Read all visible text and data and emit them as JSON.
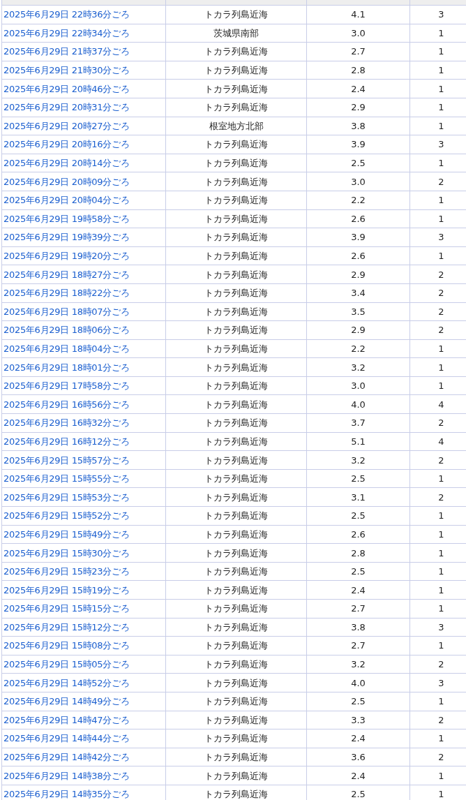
{
  "table": {
    "rows": [
      {
        "time": "2025年6月29日 22時36分ごろ",
        "area": "トカラ列島近海",
        "magnitude": "4.1",
        "intensity": "3"
      },
      {
        "time": "2025年6月29日 22時34分ごろ",
        "area": "茨城県南部",
        "magnitude": "3.0",
        "intensity": "1"
      },
      {
        "time": "2025年6月29日 21時37分ごろ",
        "area": "トカラ列島近海",
        "magnitude": "2.7",
        "intensity": "1"
      },
      {
        "time": "2025年6月29日 21時30分ごろ",
        "area": "トカラ列島近海",
        "magnitude": "2.8",
        "intensity": "1"
      },
      {
        "time": "2025年6月29日 20時46分ごろ",
        "area": "トカラ列島近海",
        "magnitude": "2.4",
        "intensity": "1"
      },
      {
        "time": "2025年6月29日 20時31分ごろ",
        "area": "トカラ列島近海",
        "magnitude": "2.9",
        "intensity": "1"
      },
      {
        "time": "2025年6月29日 20時27分ごろ",
        "area": "根室地方北部",
        "magnitude": "3.8",
        "intensity": "1"
      },
      {
        "time": "2025年6月29日 20時16分ごろ",
        "area": "トカラ列島近海",
        "magnitude": "3.9",
        "intensity": "3"
      },
      {
        "time": "2025年6月29日 20時14分ごろ",
        "area": "トカラ列島近海",
        "magnitude": "2.5",
        "intensity": "1"
      },
      {
        "time": "2025年6月29日 20時09分ごろ",
        "area": "トカラ列島近海",
        "magnitude": "3.0",
        "intensity": "2"
      },
      {
        "time": "2025年6月29日 20時04分ごろ",
        "area": "トカラ列島近海",
        "magnitude": "2.2",
        "intensity": "1"
      },
      {
        "time": "2025年6月29日 19時58分ごろ",
        "area": "トカラ列島近海",
        "magnitude": "2.6",
        "intensity": "1"
      },
      {
        "time": "2025年6月29日 19時39分ごろ",
        "area": "トカラ列島近海",
        "magnitude": "3.9",
        "intensity": "3"
      },
      {
        "time": "2025年6月29日 19時20分ごろ",
        "area": "トカラ列島近海",
        "magnitude": "2.6",
        "intensity": "1"
      },
      {
        "time": "2025年6月29日 18時27分ごろ",
        "area": "トカラ列島近海",
        "magnitude": "2.9",
        "intensity": "2"
      },
      {
        "time": "2025年6月29日 18時22分ごろ",
        "area": "トカラ列島近海",
        "magnitude": "3.4",
        "intensity": "2"
      },
      {
        "time": "2025年6月29日 18時07分ごろ",
        "area": "トカラ列島近海",
        "magnitude": "3.5",
        "intensity": "2"
      },
      {
        "time": "2025年6月29日 18時06分ごろ",
        "area": "トカラ列島近海",
        "magnitude": "2.9",
        "intensity": "2"
      },
      {
        "time": "2025年6月29日 18時04分ごろ",
        "area": "トカラ列島近海",
        "magnitude": "2.2",
        "intensity": "1"
      },
      {
        "time": "2025年6月29日 18時01分ごろ",
        "area": "トカラ列島近海",
        "magnitude": "3.2",
        "intensity": "1"
      },
      {
        "time": "2025年6月29日 17時58分ごろ",
        "area": "トカラ列島近海",
        "magnitude": "3.0",
        "intensity": "1"
      },
      {
        "time": "2025年6月29日 16時56分ごろ",
        "area": "トカラ列島近海",
        "magnitude": "4.0",
        "intensity": "4"
      },
      {
        "time": "2025年6月29日 16時32分ごろ",
        "area": "トカラ列島近海",
        "magnitude": "3.7",
        "intensity": "2"
      },
      {
        "time": "2025年6月29日 16時12分ごろ",
        "area": "トカラ列島近海",
        "magnitude": "5.1",
        "intensity": "4"
      },
      {
        "time": "2025年6月29日 15時57分ごろ",
        "area": "トカラ列島近海",
        "magnitude": "3.2",
        "intensity": "2"
      },
      {
        "time": "2025年6月29日 15時55分ごろ",
        "area": "トカラ列島近海",
        "magnitude": "2.5",
        "intensity": "1"
      },
      {
        "time": "2025年6月29日 15時53分ごろ",
        "area": "トカラ列島近海",
        "magnitude": "3.1",
        "intensity": "2"
      },
      {
        "time": "2025年6月29日 15時52分ごろ",
        "area": "トカラ列島近海",
        "magnitude": "2.5",
        "intensity": "1"
      },
      {
        "time": "2025年6月29日 15時49分ごろ",
        "area": "トカラ列島近海",
        "magnitude": "2.6",
        "intensity": "1"
      },
      {
        "time": "2025年6月29日 15時30分ごろ",
        "area": "トカラ列島近海",
        "magnitude": "2.8",
        "intensity": "1"
      },
      {
        "time": "2025年6月29日 15時23分ごろ",
        "area": "トカラ列島近海",
        "magnitude": "2.5",
        "intensity": "1"
      },
      {
        "time": "2025年6月29日 15時19分ごろ",
        "area": "トカラ列島近海",
        "magnitude": "2.4",
        "intensity": "1"
      },
      {
        "time": "2025年6月29日 15時15分ごろ",
        "area": "トカラ列島近海",
        "magnitude": "2.7",
        "intensity": "1"
      },
      {
        "time": "2025年6月29日 15時12分ごろ",
        "area": "トカラ列島近海",
        "magnitude": "3.8",
        "intensity": "3"
      },
      {
        "time": "2025年6月29日 15時08分ごろ",
        "area": "トカラ列島近海",
        "magnitude": "2.7",
        "intensity": "1"
      },
      {
        "time": "2025年6月29日 15時05分ごろ",
        "area": "トカラ列島近海",
        "magnitude": "3.2",
        "intensity": "2"
      },
      {
        "time": "2025年6月29日 14時52分ごろ",
        "area": "トカラ列島近海",
        "magnitude": "4.0",
        "intensity": "3"
      },
      {
        "time": "2025年6月29日 14時49分ごろ",
        "area": "トカラ列島近海",
        "magnitude": "2.5",
        "intensity": "1"
      },
      {
        "time": "2025年6月29日 14時47分ごろ",
        "area": "トカラ列島近海",
        "magnitude": "3.3",
        "intensity": "2"
      },
      {
        "time": "2025年6月29日 14時44分ごろ",
        "area": "トカラ列島近海",
        "magnitude": "2.4",
        "intensity": "1"
      },
      {
        "time": "2025年6月29日 14時42分ごろ",
        "area": "トカラ列島近海",
        "magnitude": "3.6",
        "intensity": "2"
      },
      {
        "time": "2025年6月29日 14時38分ごろ",
        "area": "トカラ列島近海",
        "magnitude": "2.4",
        "intensity": "1"
      },
      {
        "time": "2025年6月29日 14時35分ごろ",
        "area": "トカラ列島近海",
        "magnitude": "2.5",
        "intensity": "1"
      }
    ]
  }
}
